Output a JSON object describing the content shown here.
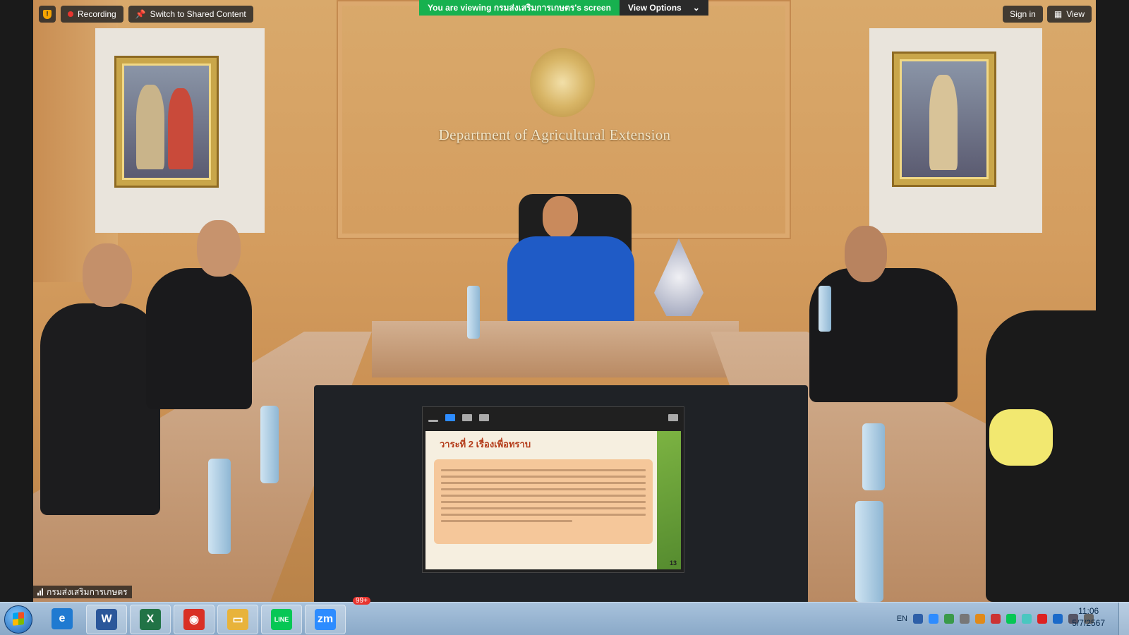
{
  "meeting": {
    "recording_label": "Recording",
    "switch_label": "Switch to Shared Content",
    "viewing_prefix": "You are viewing ",
    "presenter": "กรมส่งเสริมการเกษตร",
    "viewing_suffix": "'s screen",
    "view_options_label": "View Options",
    "sign_in_label": "Sign in",
    "view_label": "View",
    "participant_name": "กรมส่งเสริมการเกษตร"
  },
  "room": {
    "plaque_text": "Department of Agricultural Extension"
  },
  "shared_slide": {
    "title": "วาระที่ 2 เรื่องเพื่อทราบ",
    "page_number": "13"
  },
  "taskbar": {
    "apps": [
      {
        "name": "internet-explorer",
        "glyph": "e",
        "color": "#1f7ad1"
      },
      {
        "name": "word",
        "glyph": "W",
        "color": "#2b579a"
      },
      {
        "name": "excel",
        "glyph": "X",
        "color": "#217346"
      },
      {
        "name": "chrome",
        "glyph": "◉",
        "color": "#d93025"
      },
      {
        "name": "file-explorer",
        "glyph": "▭",
        "color": "#e8b33b"
      },
      {
        "name": "line",
        "glyph": "LINE",
        "color": "#06c755"
      },
      {
        "name": "zoom",
        "glyph": "zm",
        "color": "#2d8cff"
      }
    ],
    "lang": "EN",
    "time": "11:06",
    "date": "5/7/2567",
    "badge_count": "99+"
  }
}
